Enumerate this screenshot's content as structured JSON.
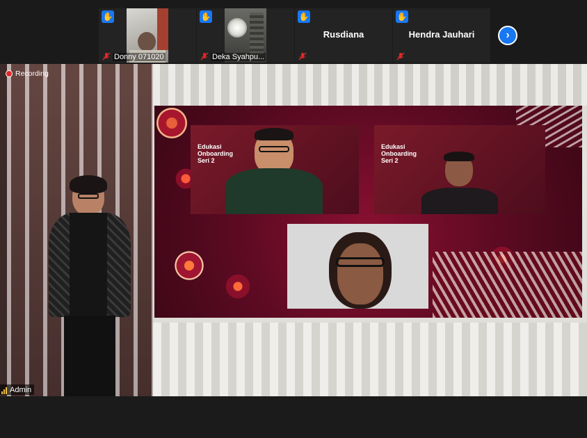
{
  "participants": [
    {
      "name": "Donny 071020",
      "hand_raised": true,
      "muted": true,
      "has_video": true
    },
    {
      "name": "Deka Syahpu...",
      "hand_raised": true,
      "muted": true,
      "has_video": true
    },
    {
      "name": "Rusdiana",
      "hand_raised": true,
      "muted": true,
      "has_video": false
    },
    {
      "name": "Hendra Jauhari",
      "hand_raised": true,
      "muted": true,
      "has_video": false
    }
  ],
  "recording": {
    "label": "Recording"
  },
  "active_speaker": {
    "name": "Admin"
  },
  "slides": [
    {
      "title": "Edukasi\nOnboarding\nSeri 2"
    },
    {
      "title": "Edukasi\nOnboarding\nSeri 2"
    }
  ],
  "colors": {
    "hand_raise": "#1877f2",
    "recording": "#e02828",
    "screen_bg": "#7a0f2c",
    "muted": "#e02828"
  },
  "icons": {
    "hand": "raise-hand-icon",
    "mic": "mic-muted-icon",
    "next": "chevron-right-icon",
    "record": "record-icon",
    "signal": "signal-icon"
  }
}
